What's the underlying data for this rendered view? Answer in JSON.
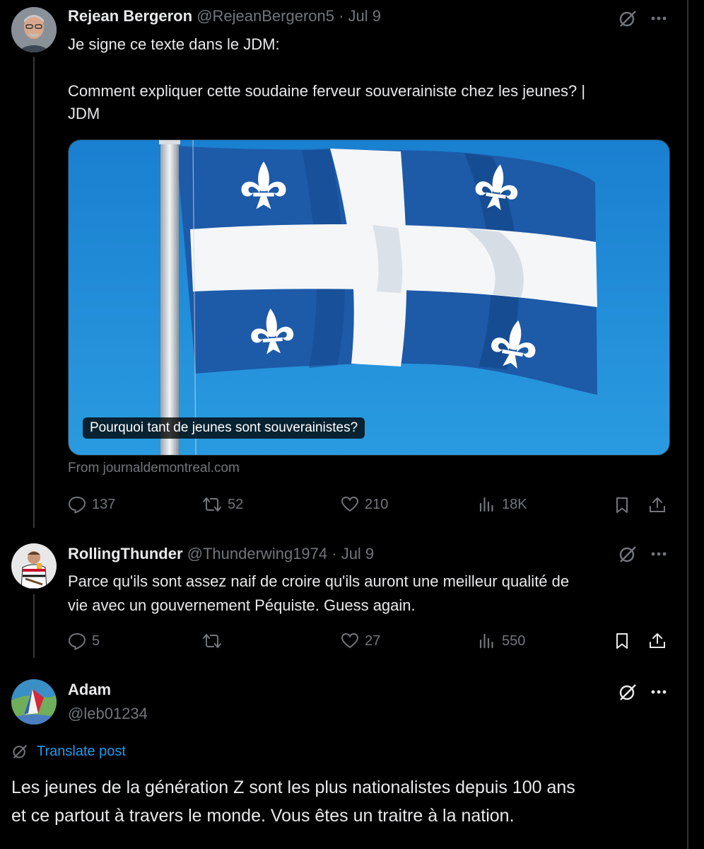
{
  "post1": {
    "name": "Rejean Bergeron",
    "handle": "@RejeanBergeron5",
    "date": "· Jul 9",
    "text_line1": "Je signe ce texte dans le JDM:",
    "text_line2": "Comment expliquer cette soudaine ferveur souverainiste chez les jeunes? |",
    "text_line3": "JDM",
    "card_caption": "Pourquoi tant de jeunes sont souverainistes?",
    "card_source": "From journaldemontreal.com",
    "replies": "137",
    "reposts": "52",
    "likes": "210",
    "views": "18K"
  },
  "post2": {
    "name": "RollingThunder",
    "handle": "@Thunderwing1974",
    "date": "· Jul 9",
    "text_line1": "Parce qu'ils sont assez naif de croire qu'ils auront une meilleur qualité de",
    "text_line2": "vie avec un gouvernement Péquiste. Guess again.",
    "replies": "5",
    "reposts": "",
    "likes": "27",
    "views": "550"
  },
  "post3": {
    "name": "Adam",
    "handle": "@leb01234",
    "translate": "Translate post",
    "text_line1": "Les jeunes de la génération Z sont les plus nationalistes depuis 100 ans",
    "text_line2": "et ce partout à travers le monde. Vous êtes un traitre à la nation."
  },
  "colors": {
    "background": "#000000",
    "text": "#e7e9ea",
    "muted": "#71767b",
    "link": "#1d9bf0",
    "flag_blue": "#1d5aa8",
    "sky": "#1f8fd6"
  },
  "icons": [
    "grok-icon",
    "more-icon",
    "reply-icon",
    "repost-icon",
    "like-icon",
    "views-icon",
    "bookmark-icon",
    "share-icon",
    "translate-icon"
  ]
}
